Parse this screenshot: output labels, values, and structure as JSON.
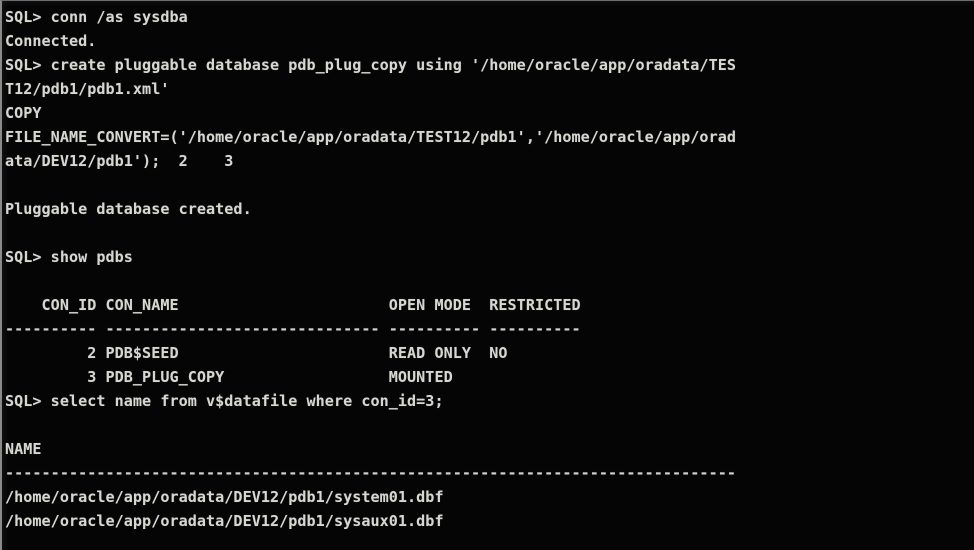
{
  "terminal": {
    "title": "SQL*Plus console",
    "prompt": "SQL>",
    "colors": {
      "background": "#050505",
      "foreground": "#d7d7d2",
      "border": "#8a8a8a"
    },
    "columns": 80,
    "lines": [
      {
        "id": "l01",
        "kind": "prompt",
        "text": "SQL> conn /as sysdba"
      },
      {
        "id": "l02",
        "kind": "output",
        "text": "Connected."
      },
      {
        "id": "l03",
        "kind": "prompt",
        "text": "SQL> create pluggable database pdb_plug_copy using '/home/oracle/app/oradata/TES"
      },
      {
        "id": "l04",
        "kind": "wrap",
        "text": "T12/pdb1/pdb1.xml'"
      },
      {
        "id": "l05",
        "kind": "input",
        "text": "COPY"
      },
      {
        "id": "l06",
        "kind": "input",
        "text": "FILE_NAME_CONVERT=('/home/oracle/app/oradata/TEST12/pdb1','/home/oracle/app/orad"
      },
      {
        "id": "l07",
        "kind": "wrap",
        "text": "ata/DEV12/pdb1');  2    3"
      },
      {
        "id": "l08",
        "kind": "blank",
        "text": ""
      },
      {
        "id": "l09",
        "kind": "output",
        "text": "Pluggable database created."
      },
      {
        "id": "l10",
        "kind": "blank",
        "text": ""
      },
      {
        "id": "l11",
        "kind": "prompt",
        "text": "SQL> show pdbs"
      },
      {
        "id": "l12",
        "kind": "blank",
        "text": ""
      },
      {
        "id": "l13",
        "kind": "header",
        "text": "    CON_ID CON_NAME                       OPEN MODE  RESTRICTED"
      },
      {
        "id": "l14",
        "kind": "rule",
        "text": "---------- ------------------------------ ---------- ----------"
      },
      {
        "id": "l15",
        "kind": "row",
        "text": "         2 PDB$SEED                       READ ONLY  NO"
      },
      {
        "id": "l16",
        "kind": "row",
        "text": "         3 PDB_PLUG_COPY                  MOUNTED"
      },
      {
        "id": "l17",
        "kind": "prompt",
        "text": "SQL> select name from v$datafile where con_id=3;"
      },
      {
        "id": "l18",
        "kind": "blank",
        "text": ""
      },
      {
        "id": "l19",
        "kind": "header",
        "text": "NAME"
      },
      {
        "id": "l20",
        "kind": "rule",
        "text": "--------------------------------------------------------------------------------"
      },
      {
        "id": "l21",
        "kind": "row",
        "text": "/home/oracle/app/oradata/DEV12/pdb1/system01.dbf"
      },
      {
        "id": "l22",
        "kind": "row",
        "text": "/home/oracle/app/oradata/DEV12/pdb1/sysaux01.dbf"
      }
    ],
    "commands": [
      {
        "name": "connect",
        "text": "conn /as sysdba"
      },
      {
        "name": "create-pluggable-database",
        "text": "create pluggable database pdb_plug_copy using '/home/oracle/app/oradata/TEST12/pdb1/pdb1.xml' COPY FILE_NAME_CONVERT=('/home/oracle/app/oradata/TEST12/pdb1','/home/oracle/app/oradata/DEV12/pdb1');"
      },
      {
        "name": "show-pdbs",
        "text": "show pdbs"
      },
      {
        "name": "select-datafiles",
        "text": "select name from v$datafile where con_id=3;"
      }
    ],
    "messages": [
      "Connected.",
      "Pluggable database created."
    ],
    "pdbs_table": {
      "headers": [
        "CON_ID",
        "CON_NAME",
        "OPEN MODE",
        "RESTRICTED"
      ],
      "rows": [
        {
          "con_id": "2",
          "con_name": "PDB$SEED",
          "open_mode": "READ ONLY",
          "restricted": "NO"
        },
        {
          "con_id": "3",
          "con_name": "PDB_PLUG_COPY",
          "open_mode": "MOUNTED",
          "restricted": ""
        }
      ]
    },
    "datafile_table": {
      "headers": [
        "NAME"
      ],
      "rows": [
        {
          "name": "/home/oracle/app/oradata/DEV12/pdb1/system01.dbf"
        },
        {
          "name": "/home/oracle/app/oradata/DEV12/pdb1/sysaux01.dbf"
        }
      ]
    },
    "continuation_markers": [
      "2",
      "3"
    ]
  }
}
